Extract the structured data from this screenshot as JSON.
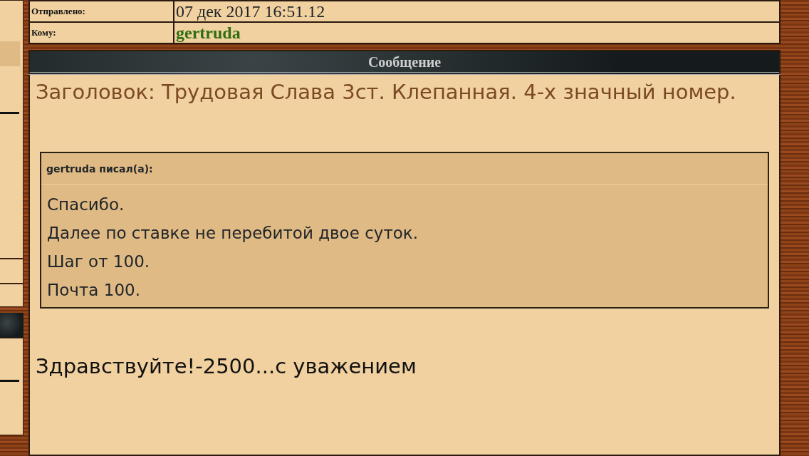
{
  "header_rows": [
    {
      "label": "Отправлено:",
      "value": "07 дек 2017 16:51.12",
      "kind": "plain"
    },
    {
      "label": "Кому:",
      "value": "gertruda",
      "kind": "user"
    }
  ],
  "section_title": "Сообщение",
  "subject": "Заголовок: Трудовая Слава 3ст. Клепанная. 4-х значный номер.",
  "quote": {
    "author": "gertruda писал(а):",
    "lines": [
      "Спасибо.",
      "Далее по ставке не перебитой двое суток.",
      "Шаг от 100.",
      "Почта 100."
    ]
  },
  "body": "Здравствуйте!-2500...с уважением"
}
